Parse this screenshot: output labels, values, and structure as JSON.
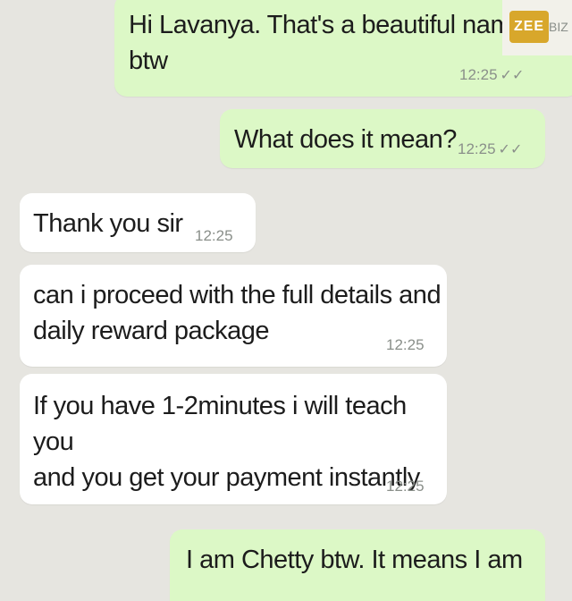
{
  "messages": [
    {
      "id": "m1",
      "direction": "outgoing",
      "text": "Hi Lavanya. That's a beautiful name\nbtw",
      "time": "12:25",
      "ticks": "✓✓"
    },
    {
      "id": "m2",
      "direction": "outgoing",
      "text": "What does it mean?",
      "time": "12:25",
      "ticks": "✓✓"
    },
    {
      "id": "m3",
      "direction": "incoming",
      "text": "Thank you sir",
      "time": "12:25"
    },
    {
      "id": "m4",
      "direction": "incoming",
      "text": "can i proceed with the full details and\ndaily reward package",
      "time": "12:25"
    },
    {
      "id": "m5",
      "direction": "incoming",
      "text": "If you have 1-2minutes i will teach you\nand you get your payment instantly",
      "time": "12:25"
    },
    {
      "id": "m6",
      "direction": "outgoing",
      "text": "I am Chetty btw. It means I am"
    }
  ],
  "watermark": {
    "label": "ZEE",
    "tail": "BIZ"
  },
  "colors": {
    "outgoing_bubble": "#dcf8c6",
    "incoming_bubble": "#ffffff",
    "background": "#e6e5e0",
    "logo": "#d8a72b"
  }
}
